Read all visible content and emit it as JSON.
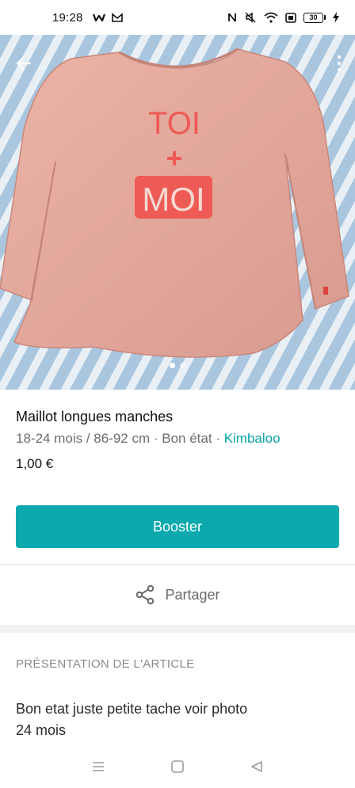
{
  "status_bar": {
    "time": "19:28",
    "left_icons": [
      "w-app-icon",
      "mail-icon"
    ],
    "right_icons": [
      "nfc-icon",
      "mute-icon",
      "wifi-icon",
      "screen-icon",
      "battery-icon"
    ],
    "battery_level": "30"
  },
  "photo": {
    "back_icon": "arrow-left-icon",
    "more_icon": "more-vert-icon",
    "print_line1": "TOI",
    "print_line2": "+",
    "print_line3": "MOI",
    "pager": {
      "count": 2,
      "active": 0
    }
  },
  "item": {
    "title": "Maillot longues manches",
    "size": "18-24 mois / 86-92 cm",
    "separator": " · ",
    "condition": "Bon état",
    "brand": "Kimbaloo",
    "price": "1,00 €"
  },
  "actions": {
    "boost_label": "Booster",
    "share_label": "Partager",
    "share_icon": "share-icon"
  },
  "presentation": {
    "heading": "PRÉSENTATION DE L'ARTICLE",
    "text": "Bon etat juste petite tache voir photo\n24 mois"
  },
  "nav": {
    "icons": [
      "menu-icon",
      "home-square-icon",
      "back-triangle-icon"
    ]
  },
  "colors": {
    "accent": "#0ba9ae",
    "brand_link": "#09a4a8",
    "shirt": "#e6aa9e",
    "print": "#ee5a55"
  }
}
